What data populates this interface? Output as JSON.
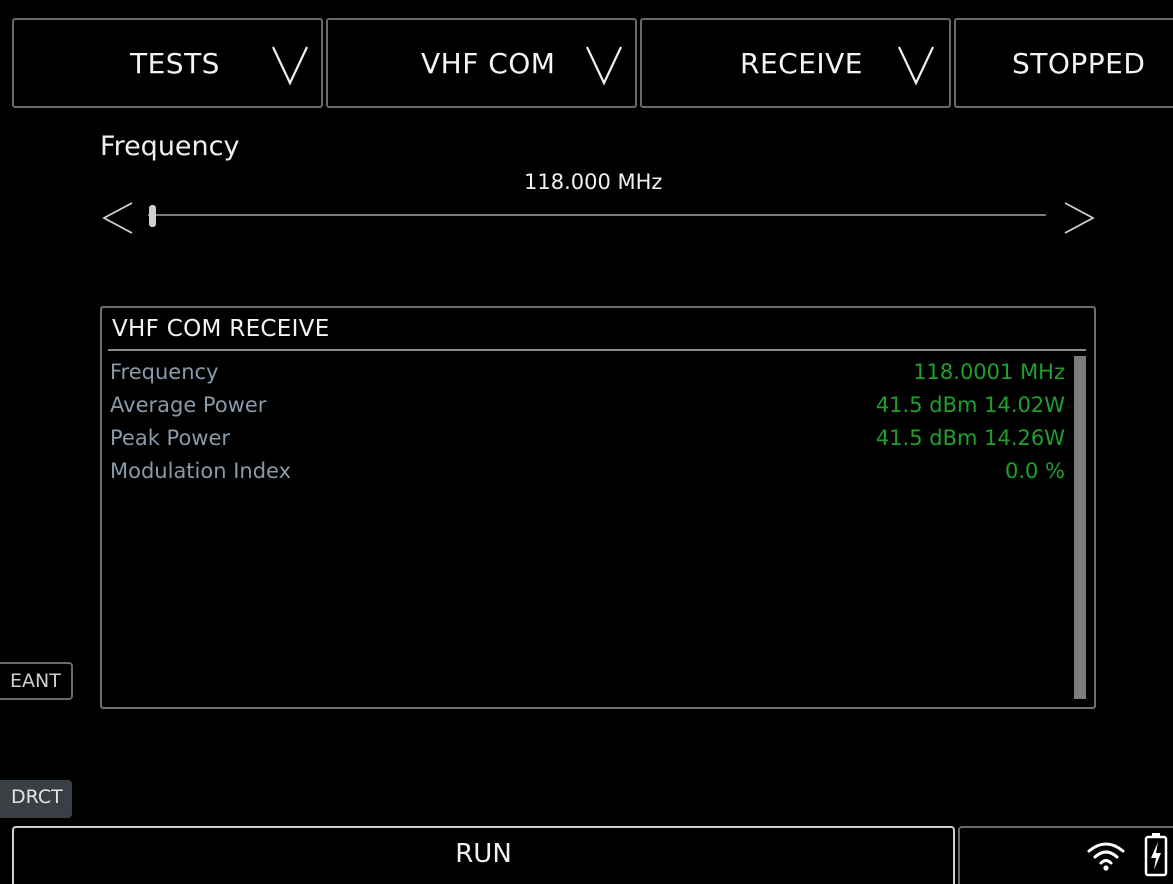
{
  "top_bar": {
    "tests_label": "TESTS",
    "system_label": "VHF COM",
    "mode_label": "RECEIVE",
    "status_label": "STOPPED"
  },
  "frequency": {
    "title": "Frequency",
    "value": "118.000 MHz",
    "slider_level_fraction": 0.0
  },
  "results_panel": {
    "title": "VHF COM RECEIVE",
    "rows": [
      {
        "label": "Frequency",
        "value": "118.0001 MHz"
      },
      {
        "label": "Average Power",
        "value": "41.5 dBm 14.02W"
      },
      {
        "label": "Peak Power",
        "value": "41.5 dBm 14.26W"
      },
      {
        "label": "Modulation Index",
        "value": "0.0 %"
      }
    ]
  },
  "side_buttons": {
    "eant_label": "EANT",
    "drct_label": "DRCT"
  },
  "bottom_bar": {
    "run_label": "RUN"
  },
  "icons": {
    "chevron": "chevron-down-icon",
    "left": "arrow-left-icon",
    "right": "arrow-right-icon",
    "wifi": "wifi-icon",
    "battery": "battery-charging-icon"
  },
  "colors": {
    "background": "#000000",
    "value_green": "#1fa02a",
    "label_grey": "#8a9aa8"
  }
}
